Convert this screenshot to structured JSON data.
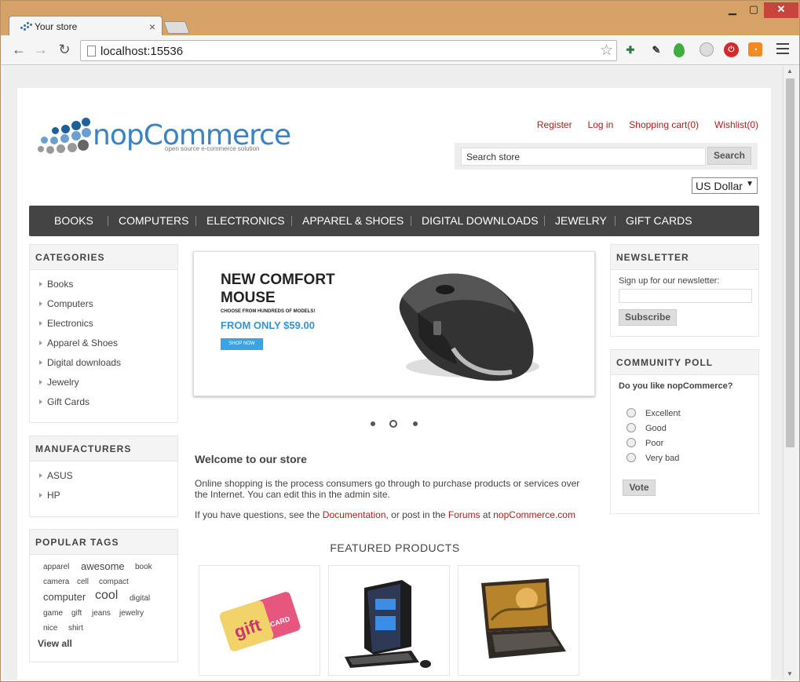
{
  "browser": {
    "tab_title": "Your store",
    "url": "localhost:15536"
  },
  "header": {
    "logo_text": "nopCommerce",
    "logo_tagline": "open source e-commerce solution",
    "links": {
      "register": "Register",
      "login": "Log in",
      "cart": "Shopping cart(0)",
      "wishlist": "Wishlist(0)"
    },
    "search": {
      "value": "Search store",
      "button": "Search"
    },
    "currency": "US Dollar"
  },
  "topmenu": [
    "BOOKS",
    "COMPUTERS",
    "ELECTRONICS",
    "APPAREL & SHOES",
    "DIGITAL DOWNLOADS",
    "JEWELRY",
    "GIFT CARDS"
  ],
  "categories": {
    "title": "CATEGORIES",
    "items": [
      "Books",
      "Computers",
      "Electronics",
      "Apparel & Shoes",
      "Digital downloads",
      "Jewelry",
      "Gift Cards"
    ]
  },
  "manufacturers": {
    "title": "MANUFACTURERS",
    "items": [
      "ASUS",
      "HP"
    ]
  },
  "popular_tags": {
    "title": "POPULAR TAGS",
    "tags": [
      "apparel",
      "awesome",
      "book",
      "camera",
      "cell",
      "compact",
      "computer",
      "cool",
      "digital",
      "game",
      "gift",
      "jeans",
      "jewelry",
      "nice",
      "shirt"
    ],
    "view_all": "View all"
  },
  "slider": {
    "headline": "NEW COMFORT MOUSE",
    "subline": "CHOOSE FROM HUNDREDS OF MODELS!",
    "price": "FROM ONLY $59.00",
    "button": "SHOP NOW",
    "active_slide": 2,
    "slide_count": 3
  },
  "welcome": {
    "title": "Welcome to our store",
    "p1": "Online shopping is the process consumers go through to purchase products or services over the Internet. You can edit this in the admin site.",
    "p2_a": "If you have questions, see the ",
    "p2_link1": "Documentation",
    "p2_b": ", or post in the ",
    "p2_link2": "Forums",
    "p2_c": " at ",
    "p2_link3": "nopCommerce.com"
  },
  "featured": {
    "title": "FEATURED PRODUCTS",
    "gift_card_text": "gift",
    "gift_card_sub": "CARD"
  },
  "newsletter": {
    "title": "NEWSLETTER",
    "label": "Sign up for our newsletter:",
    "button": "Subscribe"
  },
  "poll": {
    "title": "COMMUNITY POLL",
    "question": "Do you like nopCommerce?",
    "options": [
      "Excellent",
      "Good",
      "Poor",
      "Very bad"
    ],
    "button": "Vote"
  },
  "colors": {
    "accent_link": "#a5231c",
    "menu_bg": "#444444",
    "logo_blue": "#3a82c4"
  }
}
